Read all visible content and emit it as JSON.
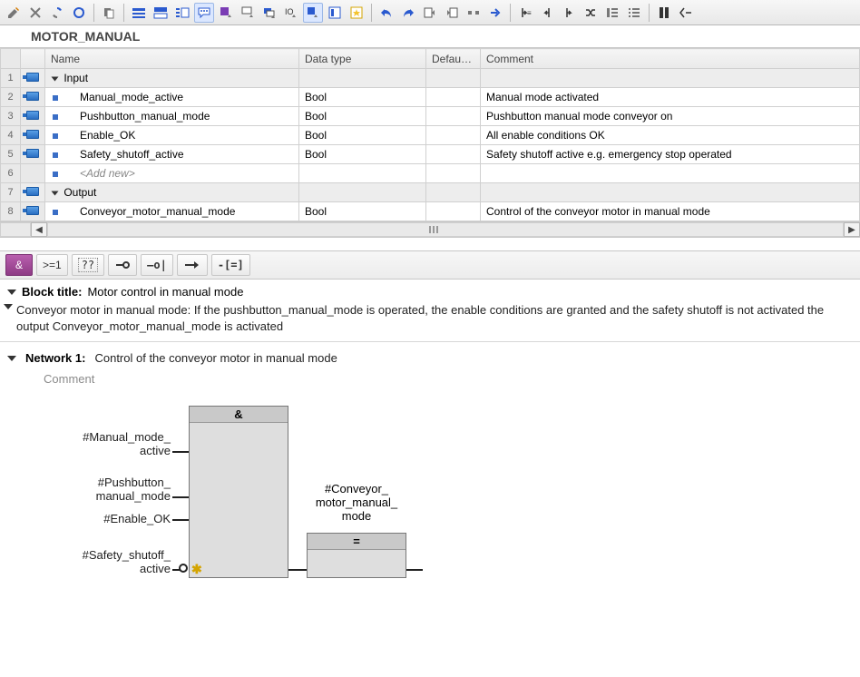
{
  "toolbar": {
    "icons": [
      "edit",
      "delete",
      "sync",
      "refresh",
      "copy",
      "view-blue",
      "view-split",
      "view-list",
      "comment",
      "settings-down",
      "monitor-down",
      "offset-down",
      "io-down",
      "export-down",
      "align",
      "favorite",
      "undo",
      "redo",
      "goto-left",
      "goto-right",
      "dash",
      "arrow-right",
      "bracket-in",
      "nav-left",
      "nav-right",
      "shuffle",
      "list1",
      "list2",
      "columns",
      "expand"
    ]
  },
  "block_name": "MOTOR_MANUAL",
  "iface": {
    "headers": [
      "",
      "Name",
      "Data type",
      "Defau…",
      "Comment"
    ],
    "rows": [
      {
        "n": "1",
        "kind": "section",
        "name": "Input"
      },
      {
        "n": "2",
        "kind": "var",
        "name": "Manual_mode_active",
        "dtype": "Bool",
        "def": "",
        "comment": "Manual mode activated"
      },
      {
        "n": "3",
        "kind": "var",
        "name": "Pushbutton_manual_mode",
        "dtype": "Bool",
        "def": "",
        "comment": "Pushbutton manual mode conveyor on"
      },
      {
        "n": "4",
        "kind": "var",
        "name": "Enable_OK",
        "dtype": "Bool",
        "def": "",
        "comment": "All enable conditions OK"
      },
      {
        "n": "5",
        "kind": "var",
        "name": "Safety_shutoff_active",
        "dtype": "Bool",
        "def": "",
        "comment": "Safety shutoff active e.g. emergency stop operated"
      },
      {
        "n": "6",
        "kind": "add",
        "name": "<Add new>"
      },
      {
        "n": "7",
        "kind": "section",
        "name": "Output"
      },
      {
        "n": "8",
        "kind": "var",
        "name": "Conveyor_motor_manual_mode",
        "dtype": "Bool",
        "def": "",
        "comment": "Control of the conveyor motor in manual mode"
      }
    ]
  },
  "fbdbar": {
    "and": "&",
    "or": ">=1",
    "empty": "⁇",
    "not": "⊣",
    "reset": "—o|",
    "jump": "↦",
    "branch": "-[=]"
  },
  "block_title_label": "Block title:",
  "block_title": "Motor control in manual mode",
  "block_comment": "Conveyor motor in manual mode: If the pushbutton_manual_mode is operated, the enable conditions are granted and the safety shutoff is not activated the output Conveyor_motor_manual_mode is activated",
  "network": {
    "label": "Network 1:",
    "title": "Control of the conveyor motor in manual mode",
    "comment": "Comment"
  },
  "diagram": {
    "and_hdr": "&",
    "eq_hdr": "=",
    "in1": "#Manual_mode_\nactive",
    "in2": "#Pushbutton_\nmanual_mode",
    "in3": "#Enable_OK",
    "in4": "#Safety_shutoff_\nactive",
    "out": "#Conveyor_\nmotor_manual_\nmode"
  }
}
